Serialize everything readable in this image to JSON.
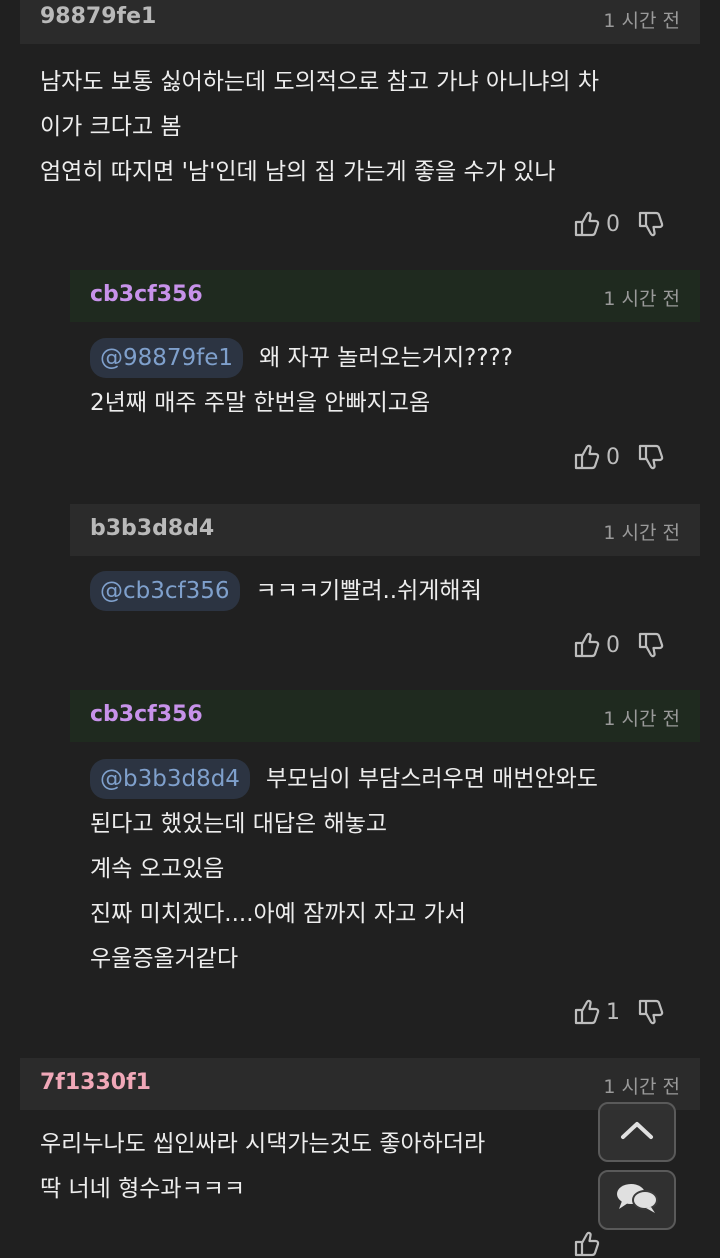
{
  "comments": [
    {
      "author": "98879fe1",
      "time": "1 시간 전",
      "lines": [
        "남자도 보통 싫어하는데 도의적으로 참고 가냐 아니냐의 차",
        "이가 크다고 봄",
        "엄연히 따지면 '남'인데 남의 집 가는게 좋을 수가 있나"
      ],
      "likes": "0"
    },
    {
      "author": "cb3cf356",
      "time": "1 시간 전",
      "mention": "@98879fe1",
      "lines": [
        "왜 자꾸 놀러오는거지????",
        "2년째 매주 주말 한번을 안빠지고옴"
      ],
      "likes": "0"
    },
    {
      "author": "b3b3d8d4",
      "time": "1 시간 전",
      "mention": "@cb3cf356",
      "lines": [
        "ㅋㅋㅋ기빨려..쉬게해줘"
      ],
      "likes": "0"
    },
    {
      "author": "cb3cf356",
      "time": "1 시간 전",
      "mention": "@b3b3d8d4",
      "lines": [
        "부모님이 부담스러우면 매번안와도",
        "된다고 했었는데 대답은 해놓고",
        "계속 오고있음",
        "진짜 미치겠다....아예 잠까지 자고 가서",
        "우울증올거같다"
      ],
      "likes": "1"
    },
    {
      "author": "7f1330f1",
      "time": "1 시간 전",
      "lines": [
        "우리누나도 씹인싸라 시댁가는것도 좋아하더라",
        "딱 너네 형수과ㅋㅋㅋ"
      ],
      "likes": ""
    }
  ],
  "colors": {
    "author_gray": "#b9b9b9",
    "author_purple": "#c792ea",
    "author_pink": "#f0a8b8",
    "op_header_bg": "#1f2a1f"
  },
  "buttons": {
    "scroll_top_icon": "chevron-up-icon",
    "comments_icon": "chat-bubbles-icon"
  }
}
